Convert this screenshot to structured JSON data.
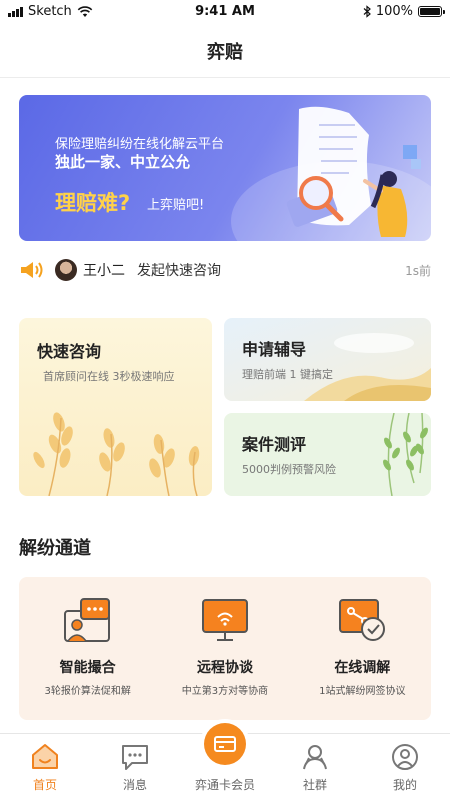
{
  "status_bar": {
    "carrier": "Sketch",
    "time": "9:41 AM",
    "battery": "100%",
    "battery_level": 1.0
  },
  "nav": {
    "title": "弈赔"
  },
  "banner": {
    "subtitle": "保险理赔纠纷在线化解云平台",
    "title": "独此一家、中立公允",
    "highlight": "理赔难?",
    "cta": "上弈赔吧!"
  },
  "notice": {
    "name": "王小二",
    "action": "发起快速咨询",
    "time": "1s前"
  },
  "services": {
    "quick": {
      "title": "快速咨询",
      "desc": "首席顾问在线 3秒极速响应"
    },
    "apply": {
      "title": "申请辅导",
      "desc": "理赔前端 1 键搞定"
    },
    "case": {
      "title": "案件测评",
      "desc": "5000判例预警风险"
    }
  },
  "section": {
    "title": "解纷通道"
  },
  "channels": [
    {
      "title": "智能撮合",
      "desc": "3轮报价算法促和解",
      "icon": "chat-presentation-icon"
    },
    {
      "title": "远程协谈",
      "desc": "中立第3方对等协商",
      "icon": "remote-monitor-icon"
    },
    {
      "title": "在线调解",
      "desc": "1站式解纷网签协议",
      "icon": "online-mediation-icon"
    }
  ],
  "tabs": [
    {
      "label": "首页",
      "icon": "home-icon",
      "active": true
    },
    {
      "label": "消息",
      "icon": "message-icon",
      "active": false
    },
    {
      "label": "弈通卡会员",
      "icon": "card-icon",
      "active": false
    },
    {
      "label": "社群",
      "icon": "community-icon",
      "active": false
    },
    {
      "label": "我的",
      "icon": "profile-icon",
      "active": false
    }
  ],
  "colors": {
    "accent": "#f58a1f",
    "banner": "#5b69e6",
    "highlight": "#ffd24a"
  }
}
